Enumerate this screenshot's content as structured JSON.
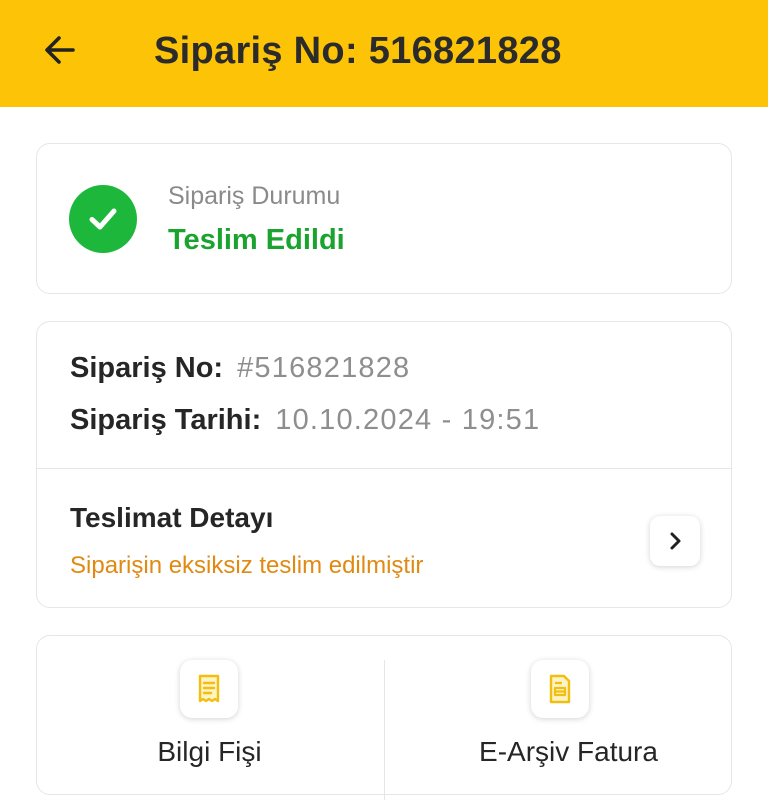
{
  "header": {
    "title": "Sipariş No: 516821828",
    "back_icon": "arrow-left-icon",
    "background_color": "#fcc307"
  },
  "status": {
    "label": "Sipariş Durumu",
    "value": "Teslim Edildi",
    "icon": "check-circle-icon",
    "color": "#1db83b"
  },
  "order_info": {
    "order_no_label": "Sipariş No:",
    "order_no_value": "#516821828",
    "order_date_label": "Sipariş Tarihi:",
    "order_date_value": "10.10.2024 - 19:51"
  },
  "delivery": {
    "title": "Teslimat Detayı",
    "subtitle": "Siparişin eksiksiz teslim edilmiştir",
    "subtitle_color": "#e08a12",
    "chevron_icon": "chevron-right-icon"
  },
  "documents": [
    {
      "label": "Bilgi Fişi",
      "icon": "receipt-icon"
    },
    {
      "label": "E-Arşiv Fatura",
      "icon": "invoice-icon"
    }
  ]
}
